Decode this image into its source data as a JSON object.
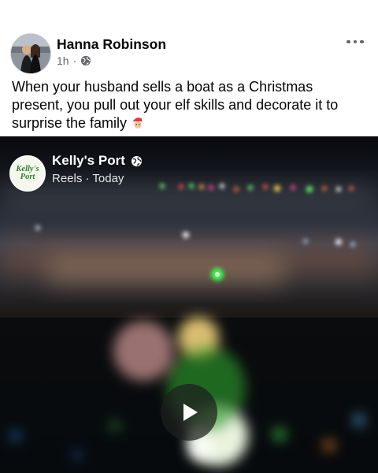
{
  "post": {
    "author": "Hanna Robinson",
    "time": "1h",
    "separator": "·",
    "text": "When your husband sells a boat as a Christmas present, you pull out your elf skills and decorate it to surprise the family",
    "emoji": "santa-emoji"
  },
  "reel": {
    "page_name": "Kelly's Port",
    "logo_line1": "Kelly's",
    "logo_line2": "Port",
    "subtitle": "Reels · Today",
    "play_icon": "play-icon"
  },
  "icons": {
    "privacy": "globe-icon",
    "more": "more-options-icon",
    "top": "chevron-down-icon"
  },
  "colors": {
    "text": "#050505",
    "secondary": "#65676b",
    "logo_green": "#2d7d2a",
    "green_light": "#39ff4e"
  }
}
